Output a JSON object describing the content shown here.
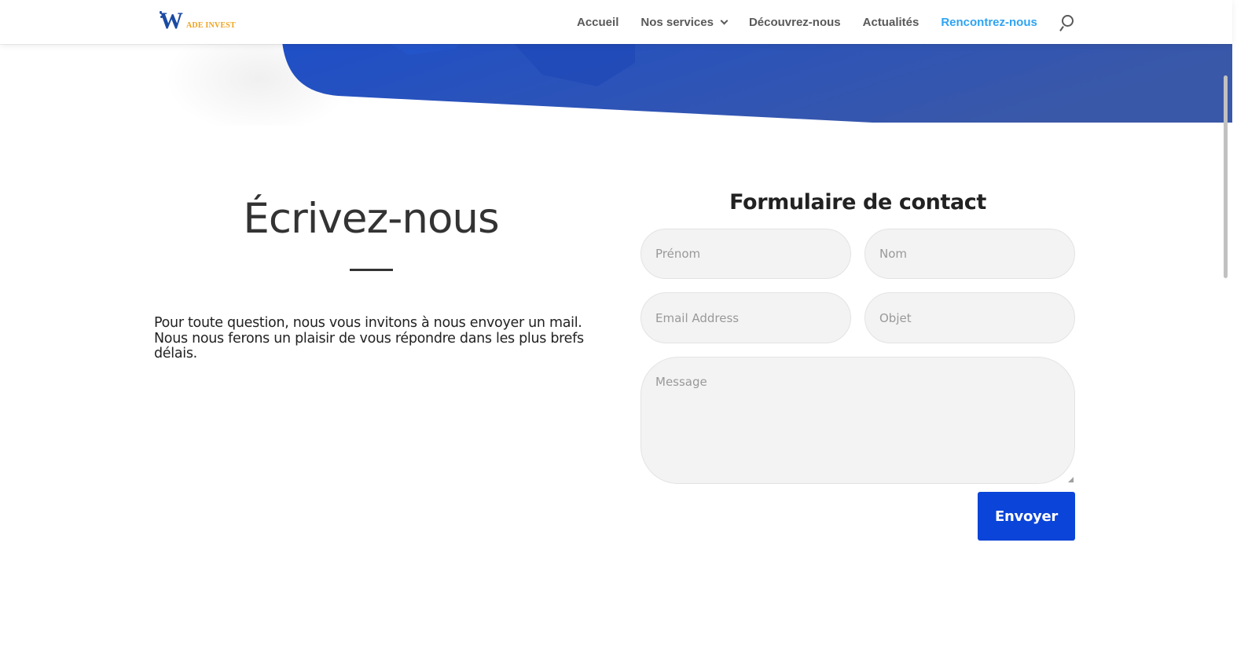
{
  "brand": {
    "logo_mark": "W",
    "logo_text": "ADE INVEST",
    "colors": {
      "gold": "#f0a31c",
      "blue": "#1b4aa3"
    }
  },
  "nav": {
    "items": [
      {
        "label": "Accueil",
        "active": false
      },
      {
        "label": "Nos services",
        "active": false,
        "has_dropdown": true
      },
      {
        "label": "Découvrez-nous",
        "active": false
      },
      {
        "label": "Actualités",
        "active": false
      },
      {
        "label": "Rencontrez-nous",
        "active": true
      }
    ],
    "search_icon": "search-icon",
    "active_color": "#2ea3f2"
  },
  "left": {
    "title": "Écrivez-nous",
    "intro": "Pour toute question, nous vous invitons à nous envoyer un mail. Nous nous ferons un plaisir de vous répondre dans les plus brefs délais."
  },
  "form": {
    "title": "Formulaire de contact",
    "fields": {
      "prenom": {
        "placeholder": "Prénom",
        "value": ""
      },
      "nom": {
        "placeholder": "Nom",
        "value": ""
      },
      "email": {
        "placeholder": "Email Address",
        "value": ""
      },
      "objet": {
        "placeholder": "Objet",
        "value": ""
      },
      "message": {
        "placeholder": "Message",
        "value": ""
      }
    },
    "submit_label": "Envoyer",
    "submit_color": "#0b44d8"
  },
  "hero": {
    "color_from": "#1e4fc8",
    "color_to": "#3a58a8"
  }
}
